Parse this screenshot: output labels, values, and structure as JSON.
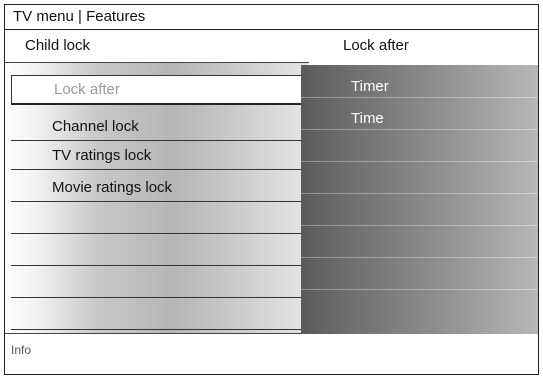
{
  "window": {
    "title": "TV menu | Features"
  },
  "left_menu": {
    "header": "Child lock",
    "items": [
      {
        "label": "Lock after",
        "selected": true
      },
      {
        "label": "Channel lock"
      },
      {
        "label": "TV ratings lock"
      },
      {
        "label": "Movie ratings lock"
      },
      {
        "label": ""
      },
      {
        "label": ""
      },
      {
        "label": ""
      },
      {
        "label": ""
      }
    ]
  },
  "right_menu": {
    "header": "Lock after",
    "items": [
      "Timer",
      "Time"
    ]
  },
  "footer": {
    "info": "Info"
  },
  "colors": {
    "selected_text": "#9a9a9a",
    "right_panel": "#7a7a7a",
    "right_text": "#ffffff"
  }
}
